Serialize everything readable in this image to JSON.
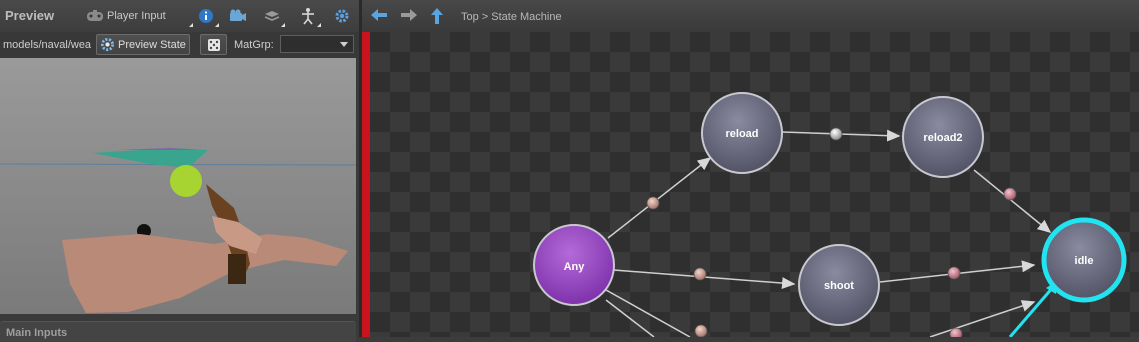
{
  "preview": {
    "title": "Preview",
    "player_input_label": "Player Input",
    "path": "models/naval/wea",
    "preview_state_label": "Preview State",
    "matgrp_label": "MatGrp:",
    "matgrp_value": "",
    "main_inputs_label": "Main Inputs",
    "toolbar_icons": [
      "gamepad-icon",
      "info-icon",
      "camera-icon",
      "layers-icon",
      "skeleton-icon",
      "settings-gear-icon"
    ]
  },
  "graph": {
    "breadcrumb": "Top > State Machine",
    "nav_icons": [
      "back-arrow-icon",
      "forward-arrow-icon",
      "up-arrow-icon"
    ],
    "nodes": [
      {
        "id": "any",
        "label": "Any",
        "selected": false,
        "color": "#9a4fc4"
      },
      {
        "id": "reload",
        "label": "reload",
        "selected": false,
        "color": "#6b6b80"
      },
      {
        "id": "reload2",
        "label": "reload2",
        "selected": false,
        "color": "#6b6b80"
      },
      {
        "id": "shoot",
        "label": "shoot",
        "selected": false,
        "color": "#6b6b80"
      },
      {
        "id": "idle",
        "label": "idle",
        "selected": true,
        "color": "#6b6b80"
      }
    ],
    "accent_color": "#22e4f0",
    "boundary_color": "#c8141c"
  }
}
